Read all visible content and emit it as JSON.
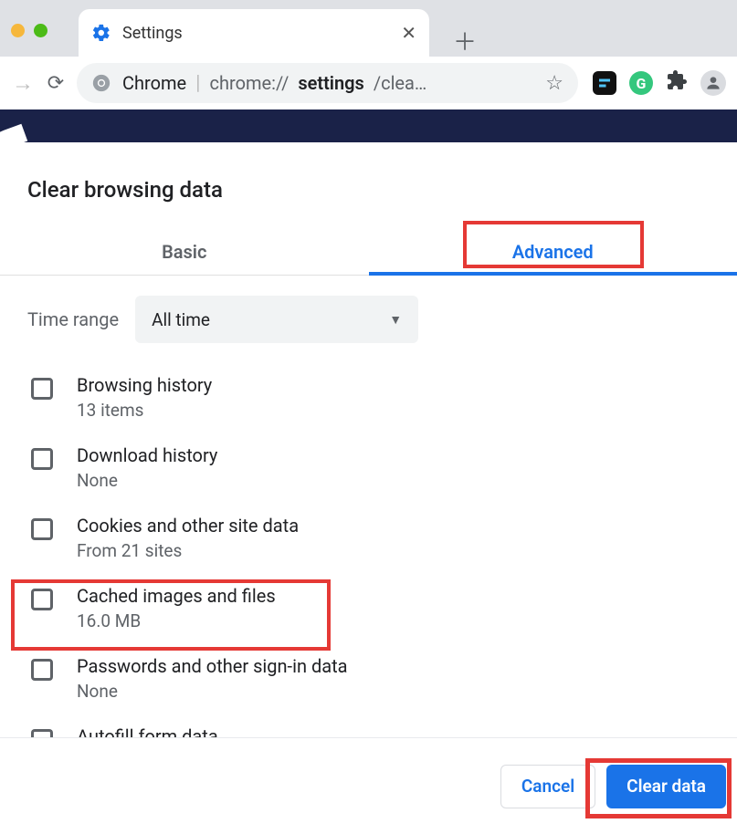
{
  "browser": {
    "tab_title": "Settings",
    "url_prefix": "Chrome",
    "url_scheme": "chrome://",
    "url_bold": "settings",
    "url_tail": "/clea…",
    "grammarly_letter": "G"
  },
  "dialog": {
    "title": "Clear browsing data",
    "tabs": {
      "basic": "Basic",
      "advanced": "Advanced"
    },
    "time_range_label": "Time range",
    "time_range_value": "All time",
    "items": [
      {
        "title": "Browsing history",
        "subtitle": "13 items"
      },
      {
        "title": "Download history",
        "subtitle": "None"
      },
      {
        "title": "Cookies and other site data",
        "subtitle": "From 21 sites"
      },
      {
        "title": "Cached images and files",
        "subtitle": "16.0 MB"
      },
      {
        "title": "Passwords and other sign-in data",
        "subtitle": "None"
      },
      {
        "title": "Autofill form data",
        "subtitle": ""
      }
    ],
    "buttons": {
      "cancel": "Cancel",
      "clear": "Clear data"
    }
  }
}
